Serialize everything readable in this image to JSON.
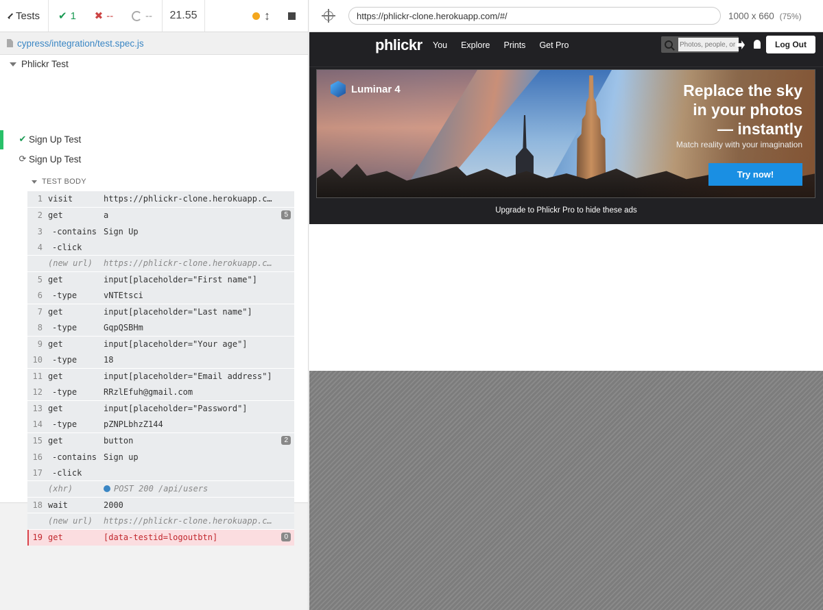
{
  "reporter": {
    "back_label": "Tests",
    "passed_count": "1",
    "failed_count": "--",
    "pending_count": "--",
    "duration": "21.55",
    "spec_path": "cypress/integration/test.spec.js",
    "suite_title": "Phlickr Test",
    "tests": [
      {
        "title": "Sign Up Test",
        "state": "passed"
      },
      {
        "title": "Sign Up Test",
        "state": "running"
      }
    ],
    "body_title": "TEST BODY",
    "commands": [
      {
        "num": "1",
        "name": "visit",
        "msg": "https://phlickr-clone.herokuapp.com/"
      },
      {
        "num": "2",
        "name": "get",
        "msg": "a",
        "badge": "5"
      },
      {
        "num": "3",
        "name": "-contains",
        "msg": "Sign Up"
      },
      {
        "num": "4",
        "name": "-click",
        "msg": ""
      },
      {
        "num": "",
        "name": "(new url)",
        "msg": "https://phlickr-clone.herokuapp.com/#/signup"
      },
      {
        "num": "5",
        "name": "get",
        "msg": "input[placeholder=\"First name\"]"
      },
      {
        "num": "6",
        "name": "-type",
        "msg": "vNTEtsci"
      },
      {
        "num": "7",
        "name": "get",
        "msg": "input[placeholder=\"Last name\"]"
      },
      {
        "num": "8",
        "name": "-type",
        "msg": "GqpQSBHm"
      },
      {
        "num": "9",
        "name": "get",
        "msg": "input[placeholder=\"Your age\"]"
      },
      {
        "num": "10",
        "name": "-type",
        "msg": "18"
      },
      {
        "num": "11",
        "name": "get",
        "msg": "input[placeholder=\"Email address\"]"
      },
      {
        "num": "12",
        "name": "-type",
        "msg": "RRzlEfuh@gmail.com"
      },
      {
        "num": "13",
        "name": "get",
        "msg": "input[placeholder=\"Password\"]"
      },
      {
        "num": "14",
        "name": "-type",
        "msg": "pZNPLbhzZ144"
      },
      {
        "num": "15",
        "name": "get",
        "msg": "button",
        "badge": "2"
      },
      {
        "num": "16",
        "name": "-contains",
        "msg": "Sign up"
      },
      {
        "num": "17",
        "name": "-click",
        "msg": ""
      },
      {
        "num": "",
        "name": "(xhr)",
        "msg": "POST 200 /api/users"
      },
      {
        "num": "18",
        "name": "wait",
        "msg": "2000"
      },
      {
        "num": "",
        "name": "(new url)",
        "msg": "https://phlickr-clone.herokuapp.com/#/feed"
      },
      {
        "num": "19",
        "name": "get",
        "msg": "[data-testid=logoutbtn]",
        "badge": "0"
      }
    ]
  },
  "aut": {
    "url": "https://phlickr-clone.herokuapp.com/#/",
    "viewport": "1000 x 660",
    "scale": "(75%)"
  },
  "app": {
    "logo": "phlickr",
    "nav": [
      "You",
      "Explore",
      "Prints",
      "Get Pro"
    ],
    "search_placeholder": "Photos, people, or groups",
    "logout_label": "Log Out",
    "ad": {
      "brand": "Luminar 4",
      "headline_1": "Replace the sky",
      "headline_2": "in your photos",
      "headline_3": "— instantly",
      "sub": "Match reality with your imagination",
      "cta": "Try now!"
    },
    "upgrade_text": "Upgrade to Phlickr Pro to hide these ads"
  },
  "colors": {
    "pass": "#1a9a53",
    "fail": "#c44",
    "cypress_link": "#3a86c4",
    "app_nav_bg": "#212124",
    "ad_cta": "#1a8fe3"
  },
  "icons": [
    "chevron-left-icon",
    "check-icon",
    "x-icon",
    "pending-circle-icon",
    "orange-status-dot",
    "resize-arrows-icon",
    "stop-icon",
    "file-icon",
    "spinner-icon",
    "crosshair-icon",
    "search-icon",
    "upload-icon",
    "bell-icon"
  ]
}
